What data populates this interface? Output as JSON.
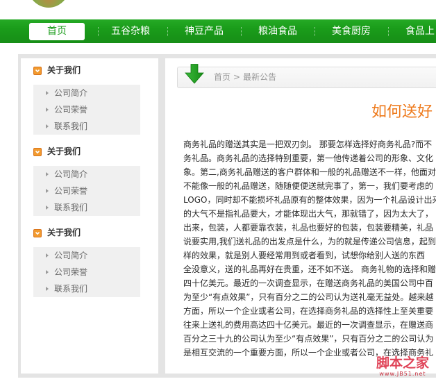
{
  "logo": {
    "icon": "logo-image"
  },
  "nav": {
    "items": [
      {
        "label": "首页",
        "active": true
      },
      {
        "label": "五谷杂粮",
        "active": false
      },
      {
        "label": "神豆产品",
        "active": false
      },
      {
        "label": "粮油食品",
        "active": false
      },
      {
        "label": "美食厨房",
        "active": false
      },
      {
        "label": "食品上",
        "active": false
      }
    ]
  },
  "sidebar": {
    "sections": [
      {
        "title": "关于我们",
        "items": [
          "公司简介",
          "公司荣誉",
          "联系我们"
        ]
      },
      {
        "title": "关于我们",
        "items": [
          "公司简介",
          "公司荣誉",
          "联系我们"
        ]
      },
      {
        "title": "关于我们",
        "items": [
          "公司简介",
          "公司荣誉",
          "联系我们"
        ]
      }
    ]
  },
  "breadcrumb": {
    "home": "首页",
    "separator": ">",
    "current": "最新公告"
  },
  "article": {
    "title": "如何送好",
    "lines": [
      "商务礼品的赠送其实是一把双刃剑。 那要怎样选择好商务礼品?而不",
      "务礼品。商务礼品的选择特别重要，第一他传递着公司的形象、文化",
      "象。第二,商务礼品赠送的客户群体和一般的礼品赠送不一样，他面对",
      "不能像一般的礼品赠送，随随便便送就完事了，第一，我们要考虑的",
      "LOGO，同时却不能损坏礼品原有的整体效果，因为一个礼品设计出来",
      "的大气不是指礼品要大，才能体现出大气，那就错了，因为太大了，",
      "出来，包装，人都要靠衣装，礼品也要好的包装，包装要精美，礼品",
      "说要实用,我们送礼品的出发点是什么，为的就是传递公司信息，起到",
      "样的效果，就是别人要经常用到或者看到，试想你给别人送的东西",
      "全没意义，送的礼品再好在贵重，还不如不送。 商务礼物的选择和赠",
      "四十亿美元。最近的一次调查显示，在赠送商务礼品的美国公司中百",
      "为至少“有点效果”，只有百分之二的公司认为送礼毫无益处。越来越",
      "方面，所以一个企业或者公司，在选择商务礼品的选择性上至关重要",
      "往来上送礼的费用高达四十亿美元。最近的一次调查显示，在赠送商",
      "百分之三十九的公司认为至少“有点效果”，只有百分之二的公司认为",
      "是相互交流的一个重要方面，所以一个企业或者公司，在选择商务礼"
    ]
  },
  "watermark": {
    "name": "脚本之家",
    "url": "www.JB51.net"
  },
  "icons": {
    "section": "chevron-down-icon",
    "bullet": "triangle-right-icon",
    "breadcrumb": "arrow-down-icon"
  },
  "colors": {
    "nav_green": "#1a9c1a",
    "nav_text": "#ffffff",
    "title_orange": "#ee7a1c",
    "watermark_red": "#e04458",
    "frame_gray": "#e4e4e4",
    "list_gray": "#f0f0f0"
  }
}
